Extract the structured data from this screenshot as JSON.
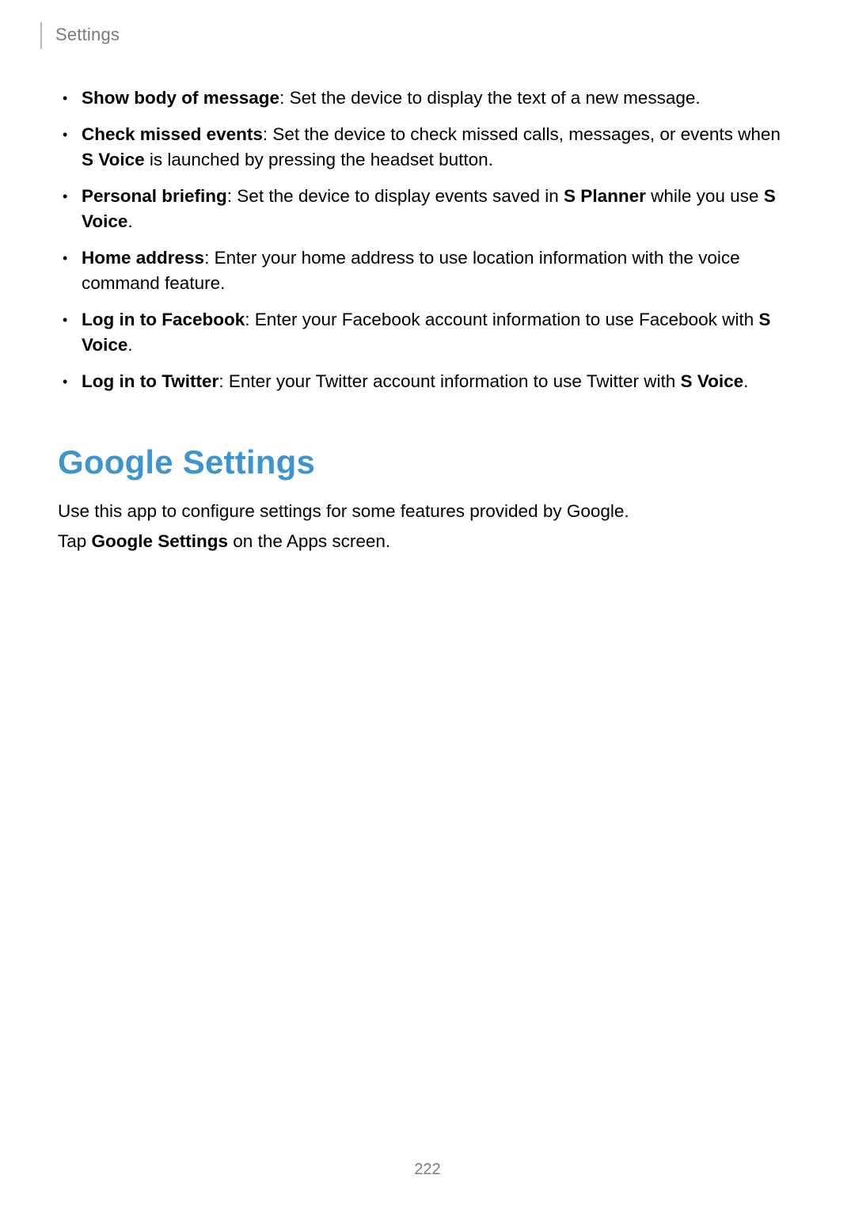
{
  "header": {
    "label": "Settings"
  },
  "list": {
    "items": [
      {
        "bold1": "Show body of message",
        "text1": ": Set the device to display the text of a new message."
      },
      {
        "bold1": "Check missed events",
        "text1": ": Set the device to check missed calls, messages, or events when ",
        "bold2": "S Voice",
        "text2": " is launched by pressing the headset button."
      },
      {
        "bold1": "Personal briefing",
        "text1": ": Set the device to display events saved in ",
        "bold2": "S Planner",
        "text2": " while you use ",
        "bold3": "S Voice",
        "text3": "."
      },
      {
        "bold1": "Home address",
        "text1": ": Enter your home address to use location information with the voice command feature."
      },
      {
        "bold1": "Log in to Facebook",
        "text1": ": Enter your Facebook account information to use Facebook with ",
        "bold2": "S Voice",
        "text2": "."
      },
      {
        "bold1": "Log in to Twitter",
        "text1": ": Enter your Twitter account information to use Twitter with ",
        "bold2": "S Voice",
        "text2": "."
      }
    ]
  },
  "section": {
    "heading": "Google Settings",
    "para1_a": "Use this app to configure settings for some features provided by Google.",
    "para2_a": "Tap ",
    "para2_bold": "Google Settings",
    "para2_b": " on the Apps screen."
  },
  "page_number": "222"
}
